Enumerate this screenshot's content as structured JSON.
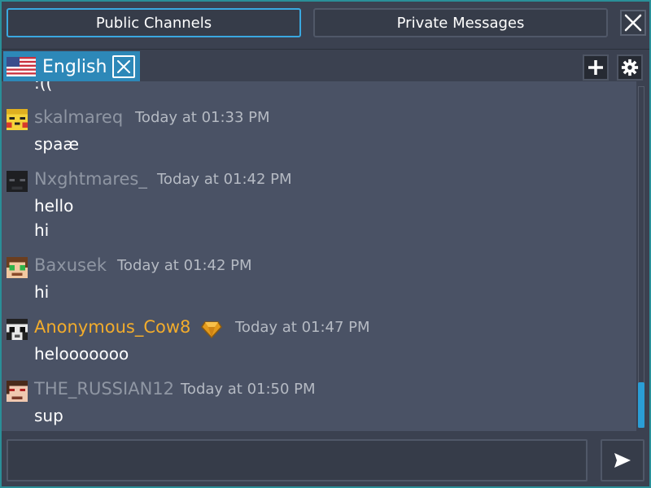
{
  "tabs": {
    "public_label": "Public Channels",
    "private_label": "Private Messages"
  },
  "icons": {
    "close": "close-icon",
    "add": "plus-icon",
    "settings": "gear-icon",
    "send": "send-icon",
    "flag": "us-flag-icon",
    "badge": "gem-icon"
  },
  "channel": {
    "label": "English"
  },
  "colors": {
    "accent": "#2d88b8",
    "active_border": "#3aa8e0",
    "gold_username": "#f2ac2c",
    "scroll_thumb": "#2a9ed6"
  },
  "messages": {
    "partial_text": ":((",
    "items": [
      {
        "username": "skalmareq",
        "timestamp": "Today at 01:33 PM",
        "lines": [
          "spaæ"
        ]
      },
      {
        "username": "Nxghtmares_",
        "timestamp": "Today at 01:42 PM",
        "lines": [
          "hello",
          "hi"
        ]
      },
      {
        "username": "Baxusek",
        "timestamp": "Today at 01:42 PM",
        "lines": [
          "hi"
        ]
      },
      {
        "username": "Anonymous_Cow8",
        "timestamp": "Today at 01:47 PM",
        "lines": [
          "helooooooo"
        ]
      },
      {
        "username": "THE_RUSSIAN12",
        "timestamp": "Today at 01:50 PM",
        "lines": [
          "sup"
        ]
      }
    ]
  },
  "input": {
    "value": "",
    "placeholder": ""
  }
}
